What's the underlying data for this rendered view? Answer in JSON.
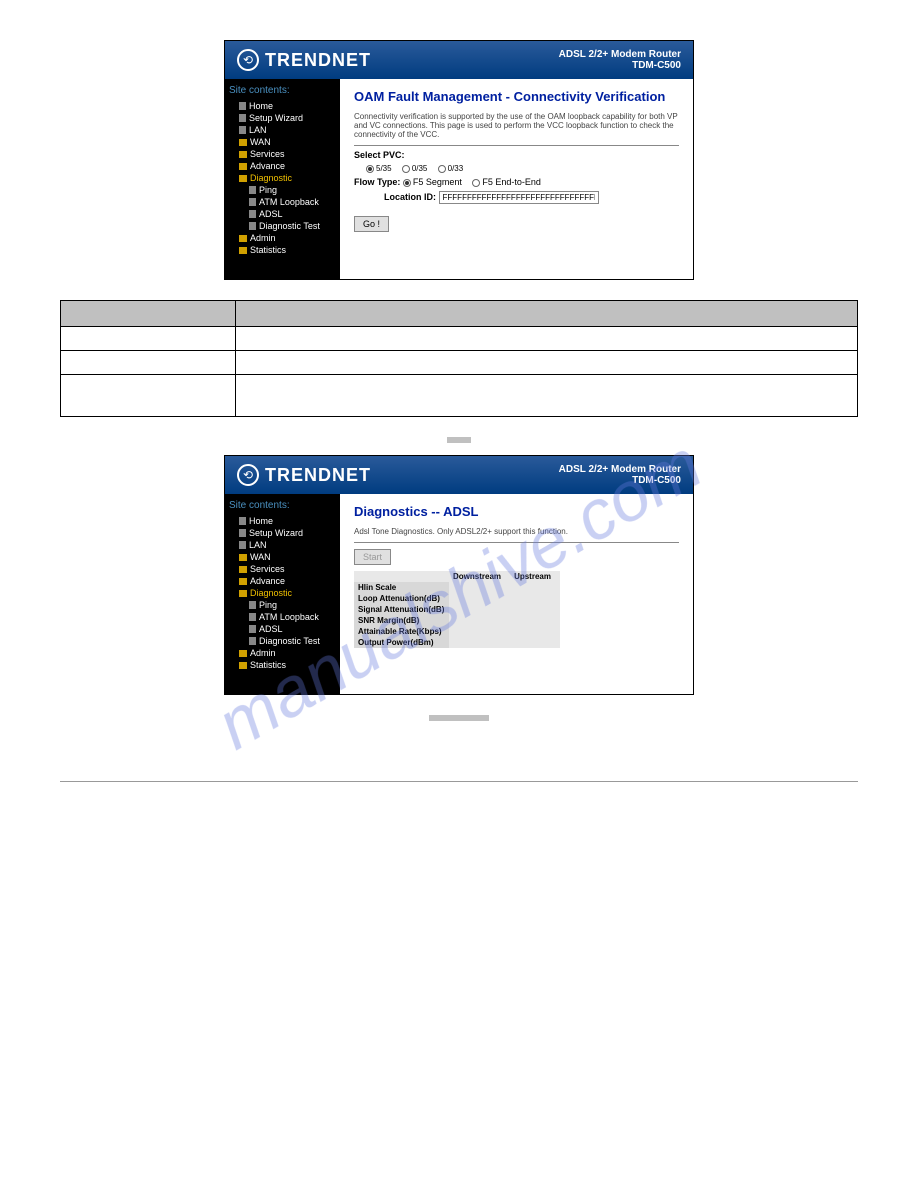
{
  "header": {
    "brand": "TRENDNET",
    "product_line": "ADSL 2/2+ Modem Router",
    "model": "TDM-C500"
  },
  "sidebar": {
    "title": "Site contents:",
    "items": [
      {
        "label": "Home"
      },
      {
        "label": "Setup Wizard"
      },
      {
        "label": "LAN"
      },
      {
        "label": "WAN"
      },
      {
        "label": "Services"
      },
      {
        "label": "Advance"
      },
      {
        "label": "Diagnostic",
        "active": true
      },
      {
        "label": "Ping",
        "sub": true
      },
      {
        "label": "ATM Loopback",
        "sub": true
      },
      {
        "label": "ADSL",
        "sub": true
      },
      {
        "label": "Diagnostic Test",
        "sub": true
      },
      {
        "label": "Admin"
      },
      {
        "label": "Statistics"
      }
    ]
  },
  "oam_page": {
    "title": "OAM Fault Management - Connectivity Verification",
    "description": "Connectivity verification is supported by the use of the OAM loopback capability for both VP and VC connections. This page is used to perform the VCC loopback function to check the connectivity of the VCC.",
    "select_pvc_label": "Select PVC:",
    "pvc_options": [
      "5/35",
      "0/35",
      "0/33"
    ],
    "flow_type_label": "Flow Type:",
    "flow_type_options": [
      "F5 Segment",
      "F5 End-to-End"
    ],
    "location_id_label": "Location ID:",
    "location_id_value": "FFFFFFFFFFFFFFFFFFFFFFFFFFFFFFFF",
    "go_button": "Go !"
  },
  "doc_table": {
    "col1_rows": [
      "",
      "",
      "",
      ""
    ],
    "col2_rows": [
      "",
      "",
      "",
      ""
    ]
  },
  "adsl_page": {
    "title": "Diagnostics -- ADSL",
    "description": "Adsl Tone Diagnostics. Only ADSL2/2+ support this function.",
    "start_button": "Start",
    "col_headers": [
      "",
      "Downstream",
      "Upstream"
    ],
    "rows": [
      {
        "label": "Hlin Scale"
      },
      {
        "label": "Loop Attenuation(dB)"
      },
      {
        "label": "Signal Attenuation(dB)"
      },
      {
        "label": "SNR Margin(dB)"
      },
      {
        "label": "Attainable Rate(Kbps)"
      },
      {
        "label": "Output Power(dBm)"
      }
    ]
  },
  "watermark": "manualshive.com"
}
